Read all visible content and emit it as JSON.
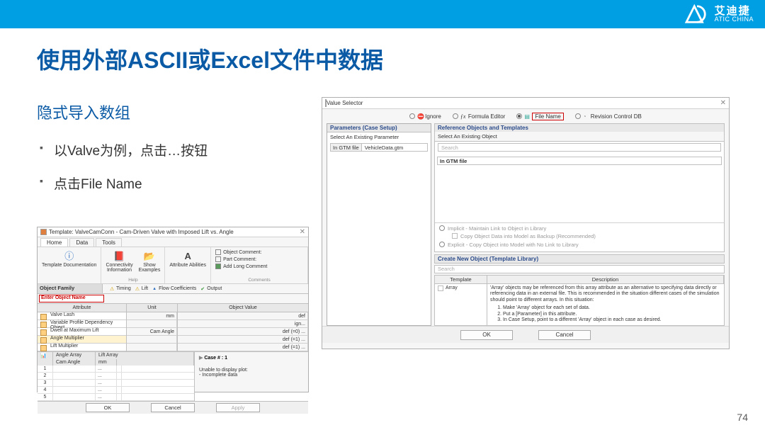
{
  "header": {
    "brand_cn": "艾迪捷",
    "brand_en": "ATIC CHINA"
  },
  "title": "使用外部ASCII或Excel文件中数据",
  "subtitle": "隐式导入数组",
  "bullets": [
    "以Valve为例，点击…按钮",
    "点击File Name"
  ],
  "page_num": "74",
  "shot1": {
    "title": "Template: ValveCamConn - Cam-Driven Valve with Imposed Lift vs. Angle",
    "tabs": [
      "Home",
      "Data",
      "Tools"
    ],
    "ribbon": {
      "btn_doc": "Template Documentation",
      "btn_conn": "Connectivity\nInformation",
      "btn_show": "Show\nExamples",
      "btn_attr": "Attribute Abilities",
      "help_label": "Help",
      "line_obj": "Object Comment:",
      "line_part": "Part Comment:",
      "line_add": "Add Long Comment",
      "comments_label": "Comments"
    },
    "of_left1": "Object Family",
    "of_input": "Enter Object Name",
    "check_timing": "Timing",
    "check_lift": "Lift",
    "check_flow": "Flow Coefficients",
    "check_output": "Output",
    "grid": {
      "hdr_attr": "Attribute",
      "hdr_unit": "Unit",
      "hdr_val": "Object Value",
      "rows": [
        {
          "attr": "Valve Lash",
          "unit": "mm",
          "val": "def"
        },
        {
          "attr": "Variable Profile Dependency Object",
          "unit": "",
          "val": "ign..."
        },
        {
          "attr": "Dwell at Maximum Lift",
          "unit": "Cam Angle",
          "val": "def (=0) ..."
        },
        {
          "attr": "Angle Multiplier",
          "unit": "",
          "val": "def (=1) ..."
        },
        {
          "attr": "Lift Multiplier",
          "unit": "",
          "val": "def (=1) ..."
        }
      ]
    },
    "lower": {
      "tab_angle": "Angle Array",
      "tab_lift": "Lift Array",
      "col_cam": "Cam Angle",
      "col_unit": "mm",
      "case": "Case # :  1",
      "err1": "Unable to display plot:",
      "err2": "- Incomplete data"
    },
    "btn_ok": "OK",
    "btn_cancel": "Cancel",
    "btn_apply": "Apply"
  },
  "shot2": {
    "title": "Value Selector",
    "opts": {
      "ignore": "Ignore",
      "formula": "Formula Editor",
      "filename": "File Name",
      "revision": "Revision Control DB"
    },
    "left": {
      "pane_title": "Parameters (Case Setup)",
      "pane_sub": "Select An Existing Parameter",
      "tag": "In GTM file",
      "val": "VehicleData.gtm"
    },
    "right": {
      "ref_title": "Reference Objects and Templates",
      "ref_sub": "Select An Existing Object",
      "search": "Search",
      "gtm": "In GTM file",
      "implicit": "Implicit - Maintain Link to Object in Library",
      "backup": "Copy Object Data into Model as Backup (Recommended)",
      "explicit": "Explicit - Copy Object into Model with No Link to Library",
      "create": "Create New Object (Template Library)",
      "tmpl_h1": "Template",
      "tmpl_h2": "Description",
      "tmpl_name": "Array",
      "desc_intro": "'Array' objects may be referenced from this array attribute as an alternative to specifying data directly or referencing data in an external file. This is recommended in the situation different cases of the simulation should point to different arrays. In this situation:",
      "desc_li1": "Make 'Array' object for each set of data.",
      "desc_li2": "Put a [Parameter] in this attribute.",
      "desc_li3": "In Case Setup, point to a different 'Array' object in each case as desired."
    },
    "btn_ok": "OK",
    "btn_cancel": "Cancel"
  }
}
